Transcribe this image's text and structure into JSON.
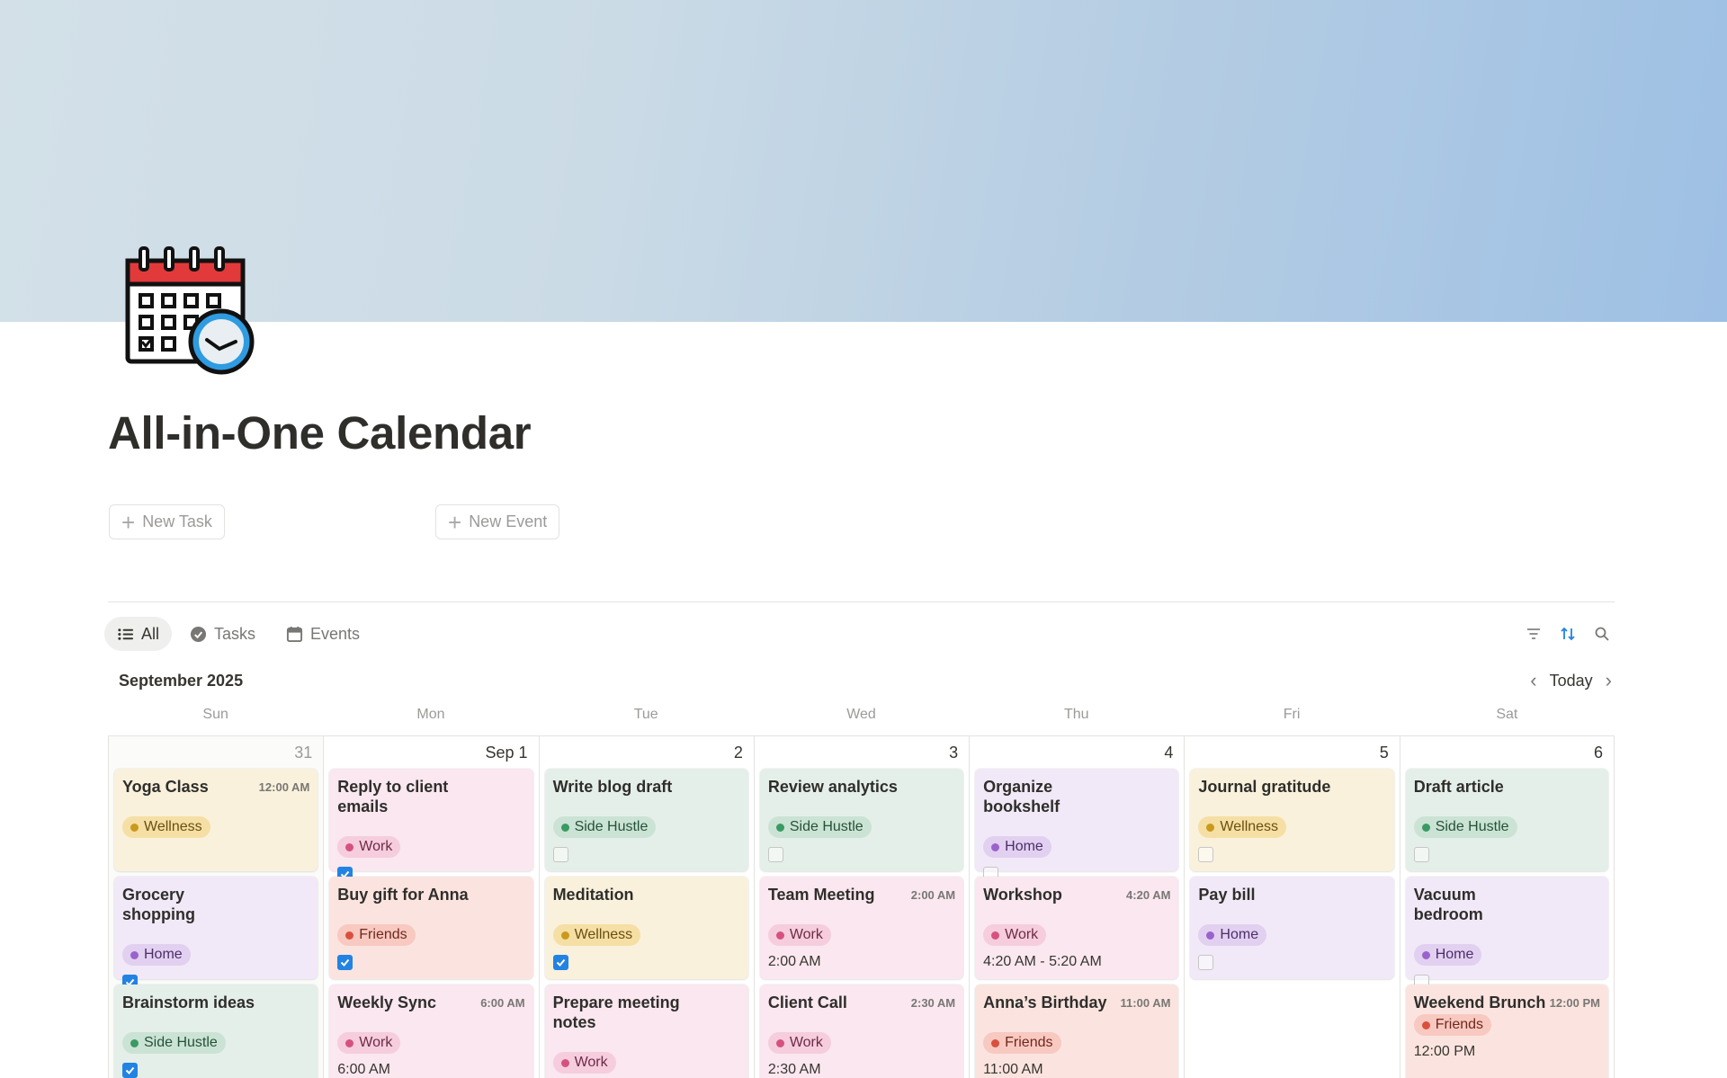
{
  "page": {
    "title": "All-in-One Calendar",
    "icon": "calendar-clock-icon"
  },
  "buttons": {
    "new_task": "New Task",
    "new_event": "New Event"
  },
  "views": [
    {
      "label": "All",
      "icon": "list-icon",
      "active": true
    },
    {
      "label": "Tasks",
      "icon": "check-circle-icon",
      "active": false
    },
    {
      "label": "Events",
      "icon": "calendar-icon",
      "active": false
    }
  ],
  "toolbar": {
    "icons": [
      "filter-icon",
      "sort-icon",
      "search-icon"
    ],
    "accent": "#2383e2"
  },
  "calendar": {
    "month": "September 2025",
    "today_label": "Today",
    "weekdays": [
      "Sun",
      "Mon",
      "Tue",
      "Wed",
      "Thu",
      "Fri",
      "Sat"
    ],
    "days": [
      {
        "label": "31",
        "cards": [
          {
            "title": "Yoga Class",
            "time": "12:00 AM",
            "tag": "Wellness",
            "kind": "wellness"
          },
          {
            "title": "Grocery shopping",
            "tag": "Home",
            "kind": "home",
            "checked": true
          },
          {
            "title": "Brainstorm ideas",
            "tag": "Side Hustle",
            "kind": "side",
            "checked": true
          }
        ]
      },
      {
        "label": "Sep 1",
        "cards": [
          {
            "title": "Reply to client emails",
            "tag": "Work",
            "kind": "work",
            "checked": true
          },
          {
            "title": "Buy gift for Anna",
            "tag": "Friends",
            "kind": "friends",
            "checked": true
          },
          {
            "title": "Weekly Sync",
            "time": "6:00 AM",
            "tag": "Work",
            "kind": "work",
            "time_line": "6:00 AM"
          }
        ]
      },
      {
        "label": "2",
        "cards": [
          {
            "title": "Write blog draft",
            "tag": "Side Hustle",
            "kind": "side",
            "checked": false
          },
          {
            "title": "Meditation",
            "tag": "Wellness",
            "kind": "wellness",
            "checked": true
          },
          {
            "title": "Prepare meeting notes",
            "tag": "Work",
            "kind": "work",
            "checked": false
          }
        ]
      },
      {
        "label": "3",
        "cards": [
          {
            "title": "Review analytics",
            "tag": "Side Hustle",
            "kind": "side",
            "checked": false
          },
          {
            "title": "Team Meeting",
            "time": "2:00 AM",
            "tag": "Work",
            "kind": "work",
            "time_line": "2:00 AM"
          },
          {
            "title": "Client Call",
            "time": "2:30 AM",
            "tag": "Work",
            "kind": "work",
            "time_line": "2:30 AM"
          }
        ]
      },
      {
        "label": "4",
        "cards": [
          {
            "title": "Organize bookshelf",
            "tag": "Home",
            "kind": "home",
            "checked": false
          },
          {
            "title": "Workshop",
            "time": "4:20 AM",
            "tag": "Work",
            "kind": "work",
            "time_line": "4:20 AM - 5:20 AM"
          },
          {
            "title": "Anna’s Birthday",
            "time": "11:00 AM",
            "tag": "Friends",
            "kind": "friends",
            "time_line": "11:00 AM"
          }
        ]
      },
      {
        "label": "5",
        "cards": [
          {
            "title": "Journal gratitude",
            "tag": "Wellness",
            "kind": "wellness",
            "checked": false
          },
          {
            "title": "Pay bill",
            "tag": "Home",
            "kind": "home",
            "checked": false
          }
        ]
      },
      {
        "label": "6",
        "cards": [
          {
            "title": "Draft article",
            "tag": "Side Hustle",
            "kind": "side",
            "checked": false
          },
          {
            "title": "Vacuum bedroom",
            "tag": "Home",
            "kind": "home",
            "checked": false
          },
          {
            "title": "Weekend Brunch",
            "time": "12:00 PM",
            "tag": "Friends",
            "kind": "friends",
            "time_line": "12:00 PM",
            "two_line": true
          }
        ]
      }
    ]
  }
}
